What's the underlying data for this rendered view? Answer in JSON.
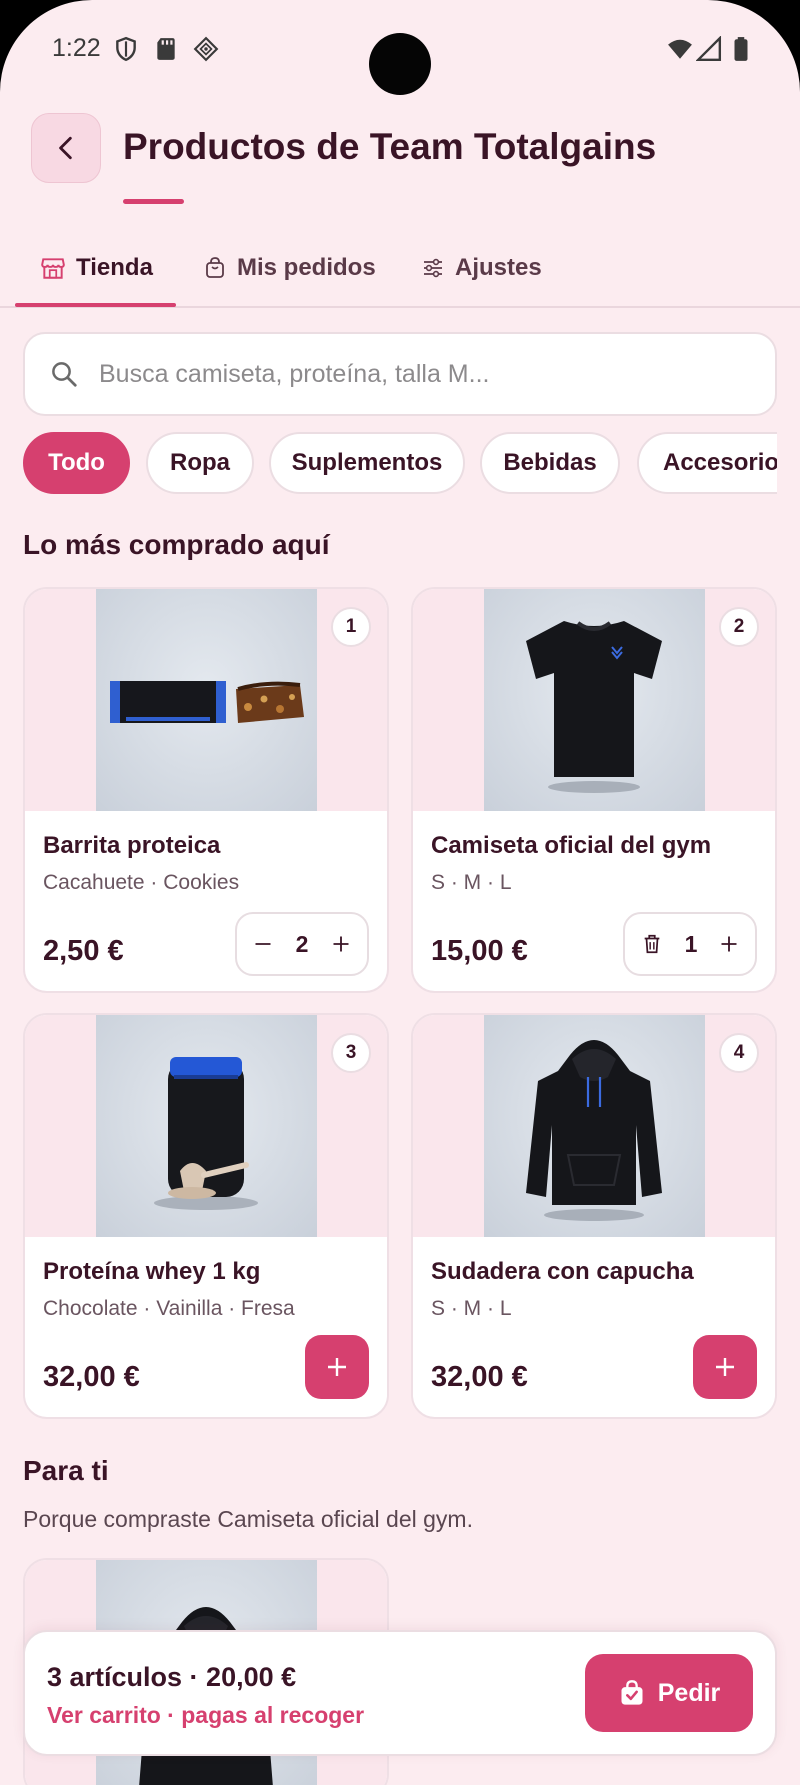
{
  "status_bar": {
    "time": "1:22"
  },
  "header": {
    "title": "Productos de Team Totalgains"
  },
  "tabs": [
    {
      "label": "Tienda",
      "icon": "store-icon",
      "active": true
    },
    {
      "label": "Mis pedidos",
      "icon": "bag-icon",
      "active": false
    },
    {
      "label": "Ajustes",
      "icon": "sliders-icon",
      "active": false
    }
  ],
  "search": {
    "placeholder": "Busca camiseta, proteína, talla M..."
  },
  "chips": [
    {
      "label": "Todo",
      "active": true
    },
    {
      "label": "Ropa",
      "active": false
    },
    {
      "label": "Suplementos",
      "active": false
    },
    {
      "label": "Bebidas",
      "active": false
    },
    {
      "label": "Accesorios",
      "active": false
    }
  ],
  "sections": {
    "top": {
      "title": "Lo más comprado aquí"
    },
    "for_you": {
      "title": "Para ti",
      "subtitle": "Porque compraste Camiseta oficial del gym."
    }
  },
  "products": [
    {
      "rank": "1",
      "name": "Barrita proteica",
      "options": "Cacahuete · Cookies",
      "price": "2,50 €",
      "quantity": "2",
      "in_cart": true
    },
    {
      "rank": "2",
      "name": "Camiseta oficial del gym",
      "options": "S · M · L",
      "price": "15,00 €",
      "quantity": "1",
      "in_cart": true
    },
    {
      "rank": "3",
      "name": "Proteína whey 1 kg",
      "options": "Chocolate · Vainilla · Fresa",
      "price": "32,00 €",
      "in_cart": false
    },
    {
      "rank": "4",
      "name": "Sudadera con capucha",
      "options": "S · M · L",
      "price": "32,00 €",
      "in_cart": false
    }
  ],
  "cart": {
    "summary": "3 artículos · 20,00 €",
    "link": "Ver carrito · pagas al recoger",
    "order_label": "Pedir"
  },
  "colors": {
    "accent": "#d6406f",
    "background": "#fcecf0",
    "text": "#3a1426"
  }
}
